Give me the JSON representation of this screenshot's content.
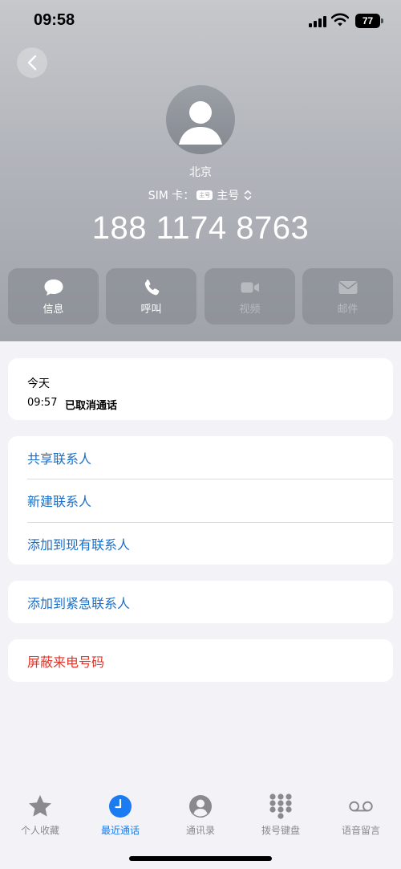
{
  "status_bar": {
    "time": "09:58",
    "battery": "77"
  },
  "contact": {
    "location": "北京",
    "sim_label": "SIM 卡：",
    "sim_badge": "主号",
    "sim_name": "主号",
    "phone_number": "188 1174 8763"
  },
  "actions": [
    {
      "label": "信息",
      "icon": "message-bubble-icon",
      "enabled": true
    },
    {
      "label": "呼叫",
      "icon": "phone-icon",
      "enabled": true
    },
    {
      "label": "视频",
      "icon": "video-camera-icon",
      "enabled": false
    },
    {
      "label": "邮件",
      "icon": "envelope-icon",
      "enabled": false
    }
  ],
  "recent": {
    "day": "今天",
    "time": "09:57",
    "status": "已取消通话"
  },
  "menu": {
    "share_contact": "共享联系人",
    "new_contact": "新建联系人",
    "add_existing": "添加到现有联系人",
    "add_emergency": "添加到紧急联系人",
    "block_caller": "屏蔽来电号码"
  },
  "tabs": [
    {
      "label": "个人收藏",
      "icon": "star-icon",
      "active": false
    },
    {
      "label": "最近通话",
      "icon": "clock-icon",
      "active": true
    },
    {
      "label": "通讯录",
      "icon": "person-circle-icon",
      "active": false
    },
    {
      "label": "拨号键盘",
      "icon": "keypad-icon",
      "active": false
    },
    {
      "label": "语音留言",
      "icon": "voicemail-icon",
      "active": false
    }
  ],
  "colors": {
    "link": "#1a6fc9",
    "destructive": "#e0352b",
    "tab_active": "#1a7cf0",
    "tab_inactive": "#8a8a8e"
  }
}
